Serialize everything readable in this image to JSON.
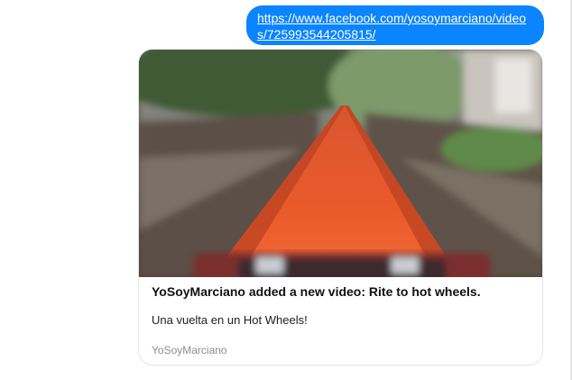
{
  "message": {
    "link_text": "https://www.facebook.com/yosoymarciano/videos/725993544205815/"
  },
  "link_preview": {
    "title": "YoSoyMarciano added a new video: Rite to hot wheels.",
    "description": "Una vuelta en un Hot Wheels!",
    "source": "YoSoyMarciano",
    "thumbnail_icon": "video-thumbnail-image"
  },
  "colors": {
    "bubble": "#0a84ff",
    "track": "#e8562a",
    "card_border": "#e2e4e8"
  }
}
